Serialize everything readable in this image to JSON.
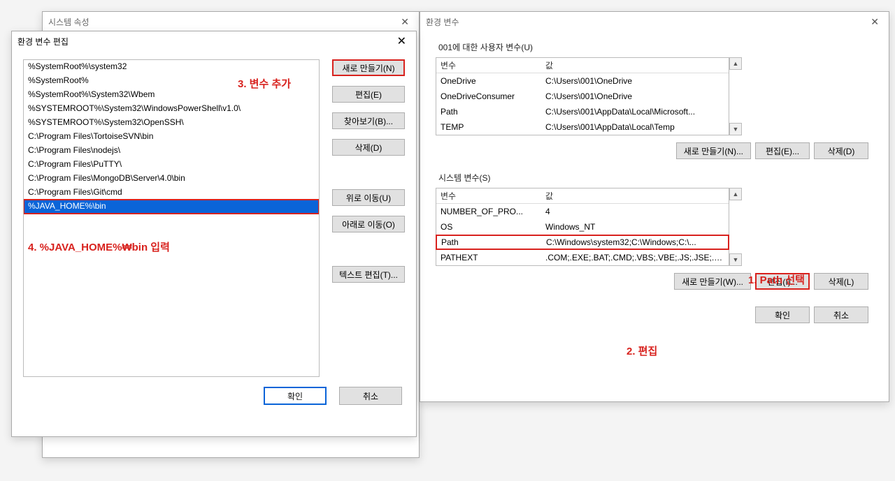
{
  "sysPropDialog": {
    "title": "시스템 속성"
  },
  "envDialog": {
    "title": "환경 변수",
    "userGroup": "001에 대한 사용자 변수(U)",
    "sysGroup": "시스템 변수(S)",
    "thead": {
      "var": "변수",
      "val": "값"
    },
    "userVars": [
      {
        "name": "OneDrive",
        "value": "C:\\Users\\001\\OneDrive"
      },
      {
        "name": "OneDriveConsumer",
        "value": "C:\\Users\\001\\OneDrive"
      },
      {
        "name": "Path",
        "value": "C:\\Users\\001\\AppData\\Local\\Microsoft..."
      },
      {
        "name": "TEMP",
        "value": "C:\\Users\\001\\AppData\\Local\\Temp"
      }
    ],
    "sysVars": [
      {
        "name": "NUMBER_OF_PRO...",
        "value": "4"
      },
      {
        "name": "OS",
        "value": "Windows_NT"
      },
      {
        "name": "Path",
        "value": "C:\\Windows\\system32;C:\\Windows;C:\\..."
      },
      {
        "name": "PATHEXT",
        "value": ".COM;.EXE;.BAT;.CMD;.VBS;.VBE;.JS;.JSE;.W..."
      }
    ],
    "btns": {
      "newUser": "새로 만들기(N)...",
      "editUser": "편집(E)...",
      "deleteUser": "삭제(D)",
      "newSys": "새로 만들기(W)...",
      "editSys": "편집(I)...",
      "deleteSys": "삭제(L)",
      "ok": "확인",
      "cancel": "취소"
    }
  },
  "editDialog": {
    "title": "환경 변수 편집",
    "paths": [
      "%SystemRoot%\\system32",
      "%SystemRoot%",
      "%SystemRoot%\\System32\\Wbem",
      "%SYSTEMROOT%\\System32\\WindowsPowerShell\\v1.0\\",
      "%SYSTEMROOT%\\System32\\OpenSSH\\",
      "C:\\Program Files\\TortoiseSVN\\bin",
      "C:\\Program Files\\nodejs\\",
      "C:\\Program Files\\PuTTY\\",
      "C:\\Program Files\\MongoDB\\Server\\4.0\\bin",
      "C:\\Program Files\\Git\\cmd",
      "%JAVA_HOME%\\bin"
    ],
    "selectedIndex": 10,
    "btns": {
      "new": "새로 만들기(N)",
      "edit": "편집(E)",
      "browse": "찾아보기(B)...",
      "delete": "삭제(D)",
      "moveUp": "위로 이동(U)",
      "moveDown": "아래로 이동(O)",
      "textEdit": "텍스트 편집(T)...",
      "ok": "확인",
      "cancel": "취소"
    }
  },
  "annotations": {
    "one": "1. Path 선택",
    "two": "2. 편집",
    "three": "3. 변수 추가",
    "four": "4. %JAVA_HOME%₩bin 입력"
  }
}
